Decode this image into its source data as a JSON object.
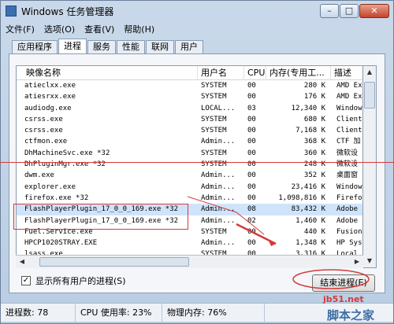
{
  "window": {
    "title": "Windows 任务管理器",
    "minimize": "–",
    "maximize": "□",
    "close": "✕"
  },
  "menu": [
    "文件(F)",
    "选项(O)",
    "查看(V)",
    "帮助(H)"
  ],
  "tabs": [
    "应用程序",
    "进程",
    "服务",
    "性能",
    "联网",
    "用户"
  ],
  "active_tab": 1,
  "columns": [
    "映像名称",
    "用户名",
    "CPU",
    "内存(专用工...",
    "描述"
  ],
  "rows": [
    [
      "atieclxx.exe",
      "SYSTEM",
      "00",
      "280 K",
      "AMD Ex"
    ],
    [
      "atiesrxx.exe",
      "SYSTEM",
      "00",
      "176 K",
      "AMD Ex"
    ],
    [
      "audiodg.exe",
      "LOCAL...",
      "03",
      "12,340 K",
      "Window"
    ],
    [
      "csrss.exe",
      "SYSTEM",
      "00",
      "680 K",
      "Client"
    ],
    [
      "csrss.exe",
      "SYSTEM",
      "00",
      "7,168 K",
      "Client"
    ],
    [
      "ctfmon.exe",
      "Admin...",
      "00",
      "368 K",
      "CTF 加"
    ],
    [
      "DhMachineSvc.exe *32",
      "SYSTEM",
      "00",
      "360 K",
      "微软设"
    ],
    [
      "DhPluginMgr.exe *32",
      "SYSTEM",
      "00",
      "248 K",
      "微软设"
    ],
    [
      "dwm.exe",
      "Admin...",
      "00",
      "352 K",
      "桌面窗"
    ],
    [
      "explorer.exe",
      "Admin...",
      "00",
      "23,416 K",
      "Window"
    ],
    [
      "firefox.exe *32",
      "Admin...",
      "00",
      "1,098,816 K",
      "Firefo"
    ],
    [
      "FlashPlayerPlugin_17_0_0_169.exe *32",
      "Admin...",
      "08",
      "83,432 K",
      "Adobe"
    ],
    [
      "FlashPlayerPlugin_17_0_0_169.exe *32",
      "Admin...",
      "02",
      "1,460 K",
      "Adobe"
    ],
    [
      "Fuel.Service.exe",
      "SYSTEM",
      "00",
      "440 K",
      "Fusion"
    ],
    [
      "HPCP1020STRAY.EXE",
      "Admin...",
      "00",
      "1,348 K",
      "HP Sys"
    ],
    [
      "lsass.exe",
      "SYSTEM",
      "00",
      "3,316 K",
      "Local"
    ]
  ],
  "selected_row": 11,
  "show_all_users_label": "显示所有用户的进程(S)",
  "show_all_users_checked": "✓",
  "end_process_label": "结束进程(E)",
  "status": {
    "processes": "进程数: 78",
    "cpu": "CPU 使用率: 23%",
    "memory": "物理内存: 76%"
  },
  "watermark": {
    "line1": "jb51.net",
    "line2": "脚本之家"
  },
  "colors": {
    "annotation_red": "#d43a3a",
    "selection": "#cfe3fb"
  }
}
